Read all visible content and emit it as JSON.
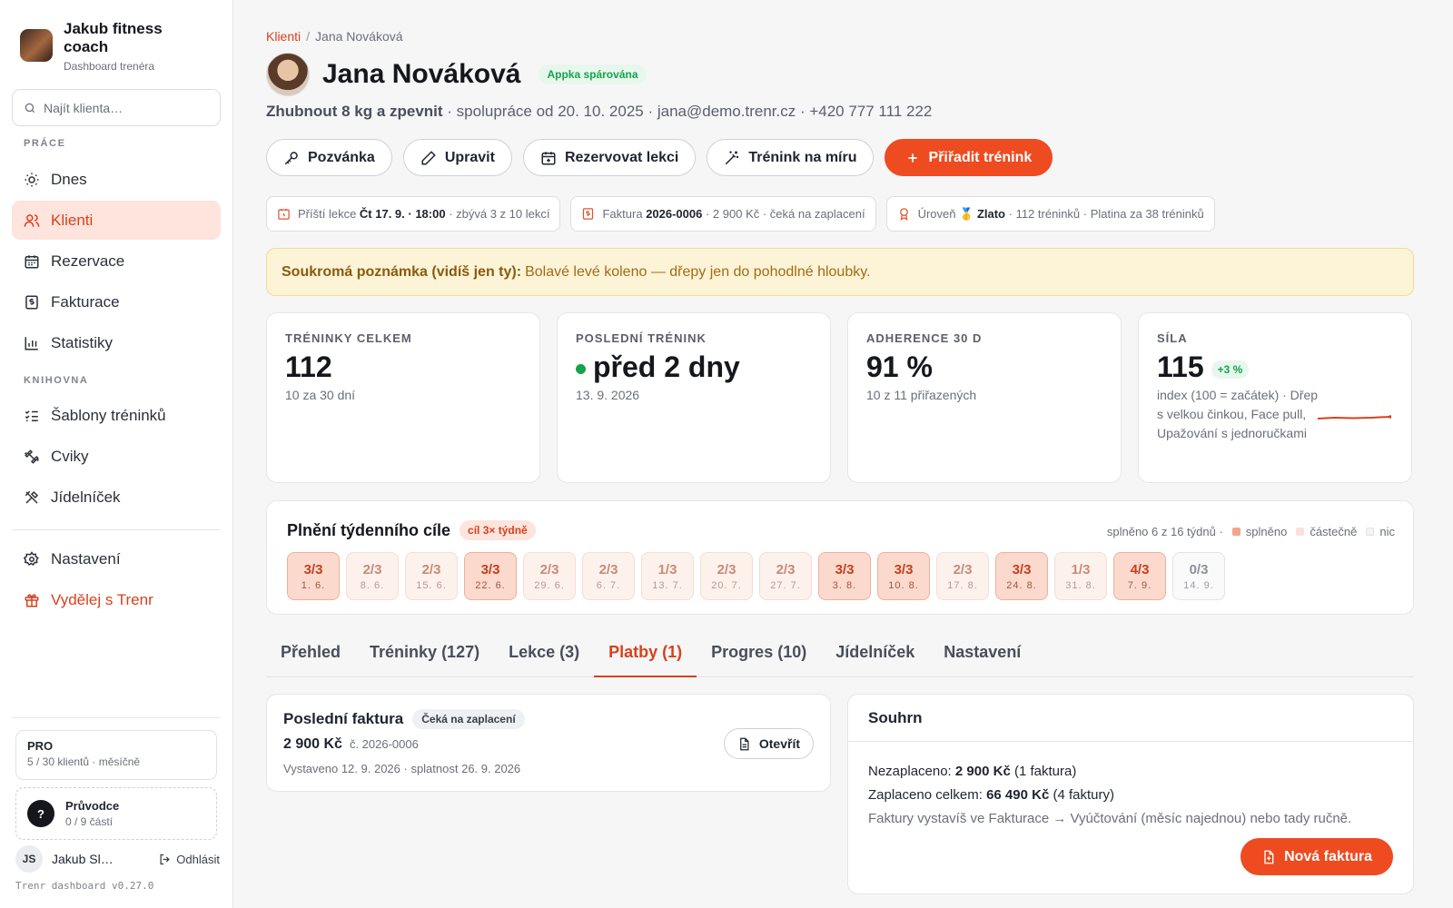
{
  "brand": {
    "name": "Jakub fitness coach",
    "subtitle": "Dashboard trenéra"
  },
  "search": {
    "placeholder": "Najít klienta…"
  },
  "sidebar": {
    "section_work": "PRÁCE",
    "section_library": "KNIHOVNA",
    "items": [
      {
        "label": "Dnes",
        "icon": "sun-icon"
      },
      {
        "label": "Klienti",
        "icon": "users-icon",
        "active": true
      },
      {
        "label": "Rezervace",
        "icon": "calendar-icon"
      },
      {
        "label": "Fakturace",
        "icon": "invoice-icon"
      },
      {
        "label": "Statistiky",
        "icon": "bar-chart-icon"
      },
      {
        "label": "Šablony tréninků",
        "icon": "list-check-icon"
      },
      {
        "label": "Cviky",
        "icon": "dumbbell-icon"
      },
      {
        "label": "Jídelníček",
        "icon": "utensils-icon"
      },
      {
        "label": "Nastavení",
        "icon": "gear-icon"
      },
      {
        "label": "Vydělej s Trenr",
        "icon": "gift-icon"
      }
    ],
    "plan": {
      "title": "PRO",
      "subtitle": "5 / 30 klientů · měsíčně"
    },
    "guide": {
      "title": "Průvodce",
      "subtitle": "0 / 9 částí"
    },
    "user": {
      "initials": "JS",
      "name": "Jakub Sl…",
      "logout": "Odhlásit"
    },
    "version": "Trenr dashboard v0.27.0"
  },
  "breadcrumb": {
    "parent": "Klienti",
    "current": "Jana Nováková"
  },
  "client": {
    "name": "Jana Nováková",
    "paired_badge": "Appka spárována",
    "goal": "Zhubnout 8 kg a zpevnit",
    "since": "· spolupráce od 20. 10. 2025 · jana@demo.trenr.cz · +420 777 111 222"
  },
  "actions": {
    "invite": "Pozvánka",
    "edit": "Upravit",
    "book": "Rezervovat lekci",
    "custom": "Trénink na míru",
    "assign": "Přiřadit trénink"
  },
  "chips": {
    "next_prefix": "Příští lekce",
    "next_value": "Čt 17. 9. · 18:00",
    "next_suffix": "· zbývá 3 z 10 lekcí",
    "invoice_prefix": "Faktura",
    "invoice_value": "2026-0006",
    "invoice_suffix": "· 2 900 Kč · čeká na zaplacení",
    "level_prefix": "Úroveň 🥇",
    "level_value": "Zlato",
    "level_suffix": "· 112 tréninků · Platina za 38 tréninků"
  },
  "note": {
    "label": "Soukromá poznámka (vidíš jen ty):",
    "text": "Bolavé levé koleno — dřepy jen do pohodlné hloubky."
  },
  "stats": {
    "total": {
      "label": "TRÉNINKY CELKEM",
      "value": "112",
      "sub": "10 za 30 dní"
    },
    "last": {
      "label": "POSLEDNÍ TRÉNINK",
      "value": "před 2 dny",
      "sub": "13. 9. 2026"
    },
    "adherence": {
      "label": "ADHERENCE 30 D",
      "value": "91 %",
      "sub": "10 z 11 přiřazených"
    },
    "strength": {
      "label": "SÍLA",
      "value": "115",
      "change": "+3 %",
      "sub": "index (100 = začátek) · Dřep s velkou činkou, Face pull, Upažování s jednoručkami"
    }
  },
  "weekly": {
    "title": "Plnění týdenního cíle",
    "goal_badge": "cíl 3× týdně",
    "summary": "splněno 6 z 16 týdnů ·",
    "legend_full": "splněno",
    "legend_partial": "částečně",
    "legend_none": "nic",
    "colors": {
      "full": "#fbd9cd",
      "partial": "#fdf1ec",
      "none": "#fafafb"
    },
    "weeks": [
      {
        "result": "3/3",
        "date": "1. 6.",
        "status": "full"
      },
      {
        "result": "2/3",
        "date": "8. 6.",
        "status": "part"
      },
      {
        "result": "2/3",
        "date": "15. 6.",
        "status": "part"
      },
      {
        "result": "3/3",
        "date": "22. 6.",
        "status": "full"
      },
      {
        "result": "2/3",
        "date": "29. 6.",
        "status": "part"
      },
      {
        "result": "2/3",
        "date": "6. 7.",
        "status": "part"
      },
      {
        "result": "1/3",
        "date": "13. 7.",
        "status": "part"
      },
      {
        "result": "2/3",
        "date": "20. 7.",
        "status": "part"
      },
      {
        "result": "2/3",
        "date": "27. 7.",
        "status": "part"
      },
      {
        "result": "3/3",
        "date": "3. 8.",
        "status": "full"
      },
      {
        "result": "3/3",
        "date": "10. 8.",
        "status": "full"
      },
      {
        "result": "2/3",
        "date": "17. 8.",
        "status": "part"
      },
      {
        "result": "3/3",
        "date": "24. 8.",
        "status": "full"
      },
      {
        "result": "1/3",
        "date": "31. 8.",
        "status": "part"
      },
      {
        "result": "4/3",
        "date": "7. 9.",
        "status": "full"
      },
      {
        "result": "0/3",
        "date": "14. 9.",
        "status": "none"
      }
    ]
  },
  "tabs": [
    "Přehled",
    "Tréninky (127)",
    "Lekce (3)",
    "Platby (1)",
    "Progres (10)",
    "Jídelníček",
    "Nastavení"
  ],
  "active_tab": 3,
  "last_invoice": {
    "title": "Poslední faktura",
    "status": "Čeká na zaplacení",
    "amount": "2 900 Kč",
    "number": "č. 2026-0006",
    "dates": "Vystaveno 12. 9. 2026 · splatnost 26. 9. 2026",
    "open": "Otevřít"
  },
  "summary": {
    "title": "Souhrn",
    "unpaid_label": "Nezaplaceno:",
    "unpaid_value": "2 900 Kč",
    "unpaid_count": "(1 faktura)",
    "paid_label": "Zaplaceno celkem:",
    "paid_value": "66 490 Kč",
    "paid_count": "(4 faktury)",
    "hint": "Faktury vystavíš ve Fakturace → Vyúčtování (měsíc najednou) nebo tady ručně.",
    "new_invoice": "Nová faktura"
  },
  "accent": "#ee4b21"
}
